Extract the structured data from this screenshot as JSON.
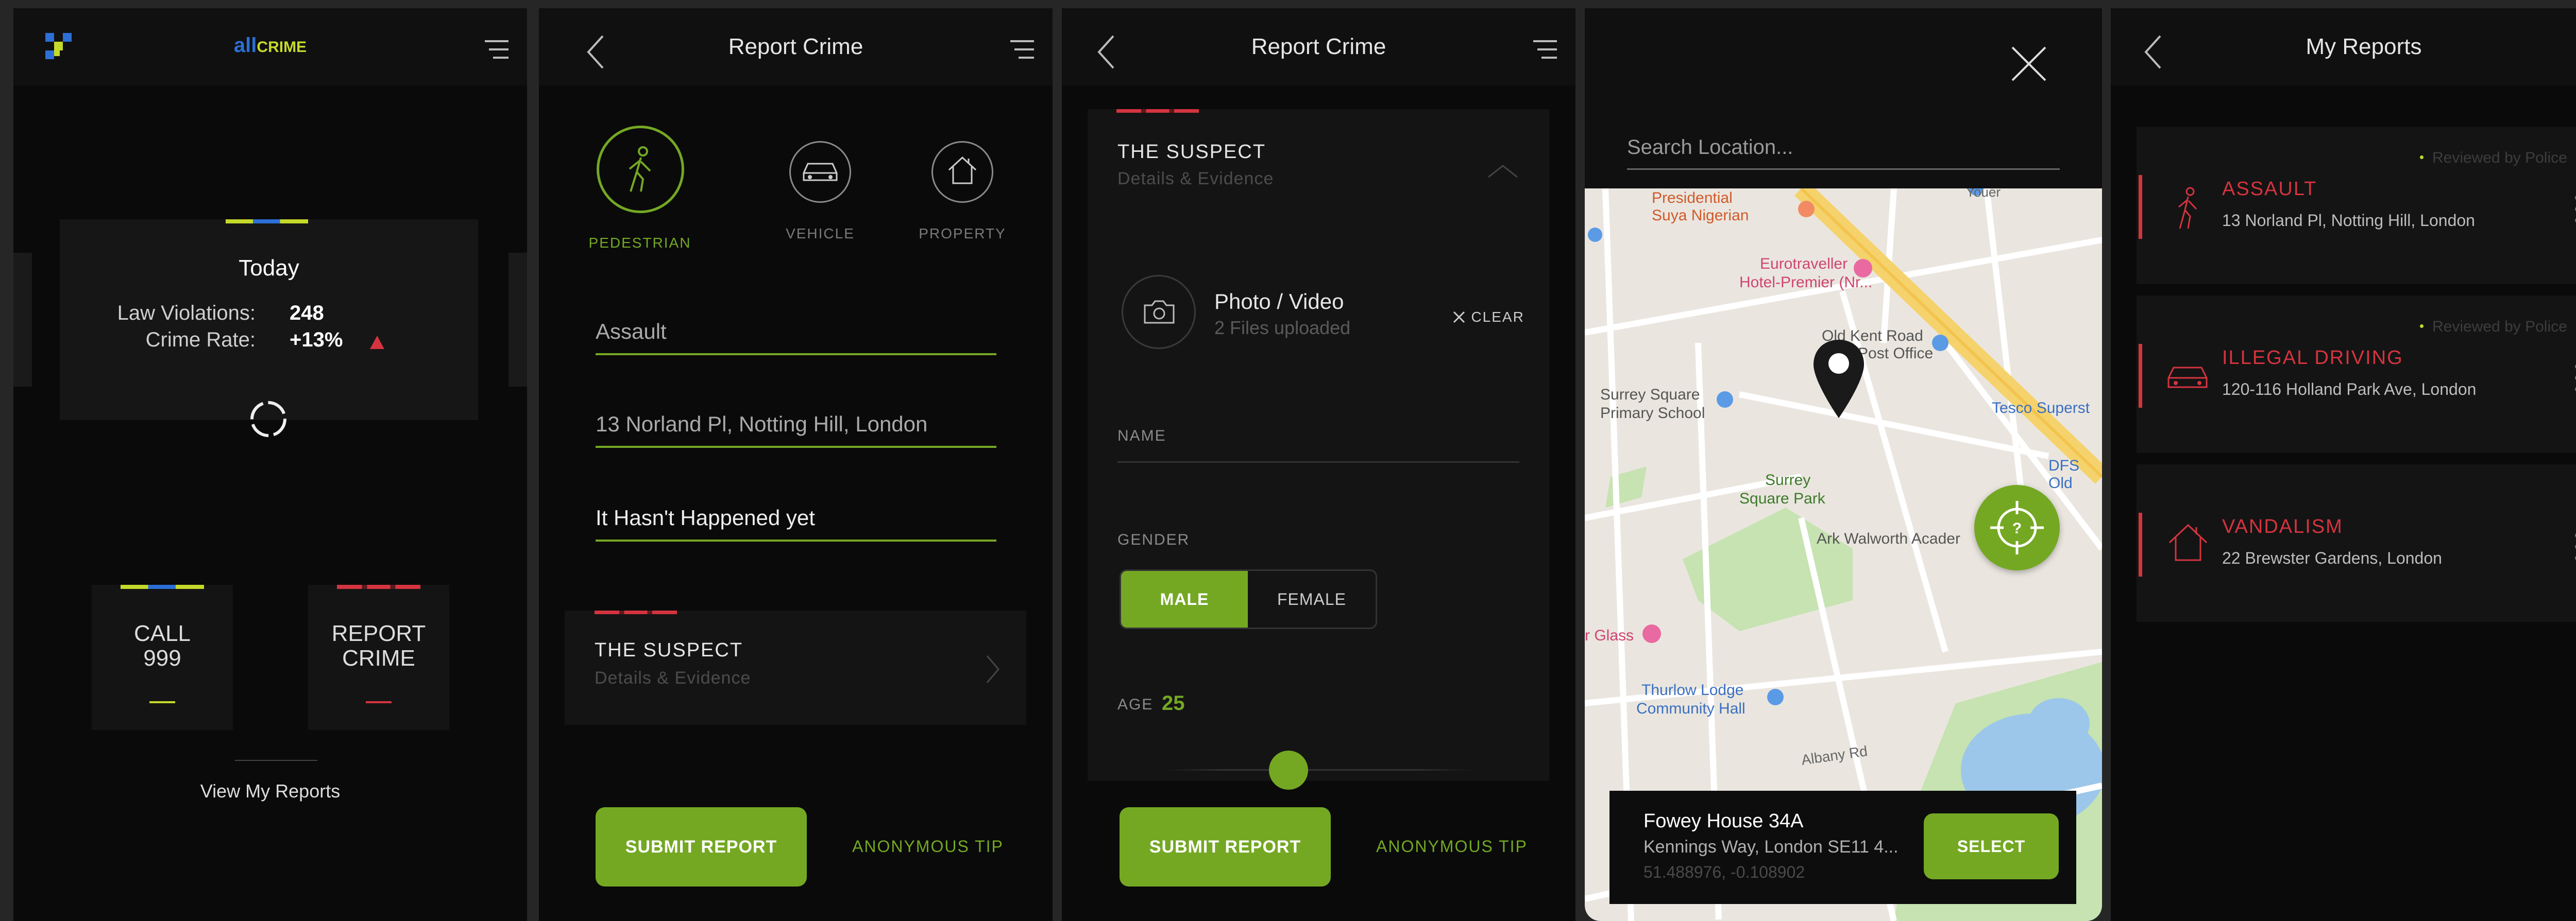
{
  "home": {
    "logo_all": "all",
    "logo_crime": "CRIME",
    "stats": {
      "title": "Today",
      "violations_label": "Law Violations:",
      "violations_value": "248",
      "rate_label": "Crime Rate:",
      "rate_value": "+13%"
    },
    "call_label_1": "CALL",
    "call_label_2": "999",
    "report_label_1": "REPORT",
    "report_label_2": "CRIME",
    "view_reports": "View My Reports"
  },
  "report1": {
    "title": "Report Crime",
    "categories": [
      {
        "label": "PEDESTRIAN",
        "icon": "pedestrian-icon",
        "active": true
      },
      {
        "label": "VEHICLE",
        "icon": "car-icon",
        "active": false
      },
      {
        "label": "PROPERTY",
        "icon": "house-icon",
        "active": false
      }
    ],
    "crime_type": "Assault",
    "location": "13 Norland Pl, Notting Hill, London",
    "time": "It Hasn't Happened yet",
    "suspect_title": "THE SUSPECT",
    "suspect_sub": "Details & Evidence",
    "submit": "SUBMIT REPORT",
    "anon": "ANONYMOUS TIP"
  },
  "report2": {
    "title": "Report Crime",
    "suspect_title": "THE SUSPECT",
    "suspect_sub": "Details & Evidence",
    "media_title": "Photo / Video",
    "media_sub": "2 Files uploaded",
    "clear": "CLEAR",
    "name_label": "NAME",
    "gender_label": "GENDER",
    "male": "MALE",
    "female": "FEMALE",
    "age_label": "AGE",
    "age_value": "25",
    "age_slider_fraction": 0.4,
    "submit": "SUBMIT REPORT",
    "anon": "ANONYMOUS TIP"
  },
  "map": {
    "search_placeholder": "Search Location...",
    "places": {
      "presidential": "Presidential",
      "suya": "Suya Nigerian",
      "eurotraveller": "Eurotraveller",
      "hotel": "Hotel-Premier (Nr...",
      "old_kent": "Old Kent Road",
      "post_office": "Post Office",
      "surrey_school": "Surrey Square",
      "primary": "Primary School",
      "tesco": "Tesco Superst",
      "surrey_park": "Surrey",
      "square_park": "Square Park",
      "ark": "Ark Walworth Acader",
      "dfs": "DFS Old",
      "glass": "r Glass",
      "thurlow": "Thurlow Lodge",
      "community": "Community Hall",
      "albany": "Albany Rd",
      "youer": "Youer"
    },
    "sheet_title": "Fowey House 34A",
    "sheet_address": "Kennings Way, London SE11 4...",
    "sheet_coords": "51.488976, -0.108902",
    "select": "SELECT"
  },
  "myreports": {
    "title": "My Reports",
    "items": [
      {
        "status": "Reviewed by Police",
        "title": "ASSAULT",
        "address": "13 Norland Pl, Notting Hill, London",
        "icon": "pedestrian-icon"
      },
      {
        "status": "Reviewed by Police",
        "title": "ILLEGAL DRIVING",
        "address": "120-116 Holland Park Ave, London",
        "icon": "car-icon"
      },
      {
        "status": "",
        "title": "VANDALISM",
        "address": "22 Brewster Gardens, London",
        "icon": "house-icon"
      }
    ]
  },
  "colors": {
    "accent_green": "#74a823",
    "alert_red": "#d4343f",
    "brand_blue": "#2c6fd6",
    "brand_lime": "#c5d92a"
  }
}
